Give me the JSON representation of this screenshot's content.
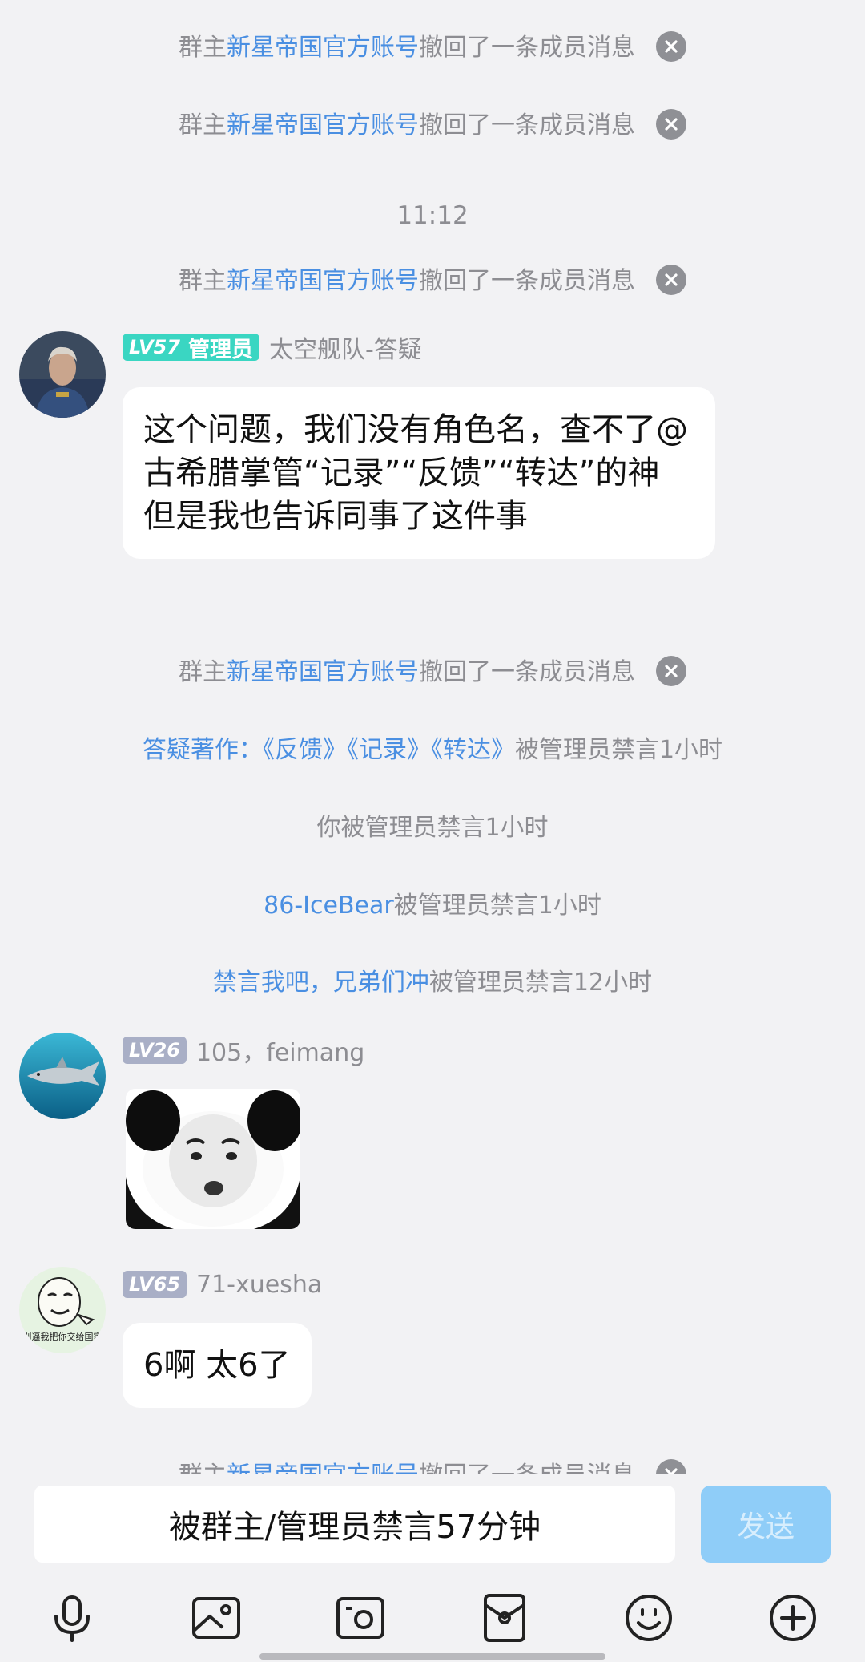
{
  "recall": {
    "prefix": "群主",
    "owner": "新星帝国官方账号",
    "suffix": "撤回了一条成员消息"
  },
  "time_label": "11:12",
  "messages": {
    "m1": {
      "level": "LV57",
      "role": "管理员",
      "nick": "太空舰队-答疑",
      "text": "这个问题，我们没有角色名，查不了@古希腊掌管“记录”“反馈”“转达”的神 但是我也告诉同事了这件事"
    },
    "m2": {
      "level": "LV26",
      "nick": "105，feimang"
    },
    "m3": {
      "level": "LV65",
      "nick": "71-xuesha",
      "text": "6啊 太6了",
      "avatar_caption": "别逼我把你交给国家"
    }
  },
  "notices": {
    "n1": {
      "name": "答疑著作：《反馈》《记录》《转达》",
      "action": "被管理员禁言1小时"
    },
    "n2": {
      "text": "你被管理员禁言1小时"
    },
    "n3": {
      "name": "86-IceBear",
      "action": "被管理员禁言1小时"
    },
    "n4": {
      "name": "禁言我吧，兄弟们冲",
      "action": "被管理员禁言12小时"
    }
  },
  "composer": {
    "muted_text": "被群主/管理员禁言57分钟",
    "send_label": "发送"
  },
  "toolbar": [
    "mic-icon",
    "photo-icon",
    "camera-icon",
    "red-packet-icon",
    "emoji-icon",
    "plus-icon"
  ],
  "colors": {
    "link": "#4a8fe2",
    "admin_badge": "#3ad6c2",
    "level_badge": "#a9afc6",
    "send_disabled": "#8fcdf8"
  }
}
